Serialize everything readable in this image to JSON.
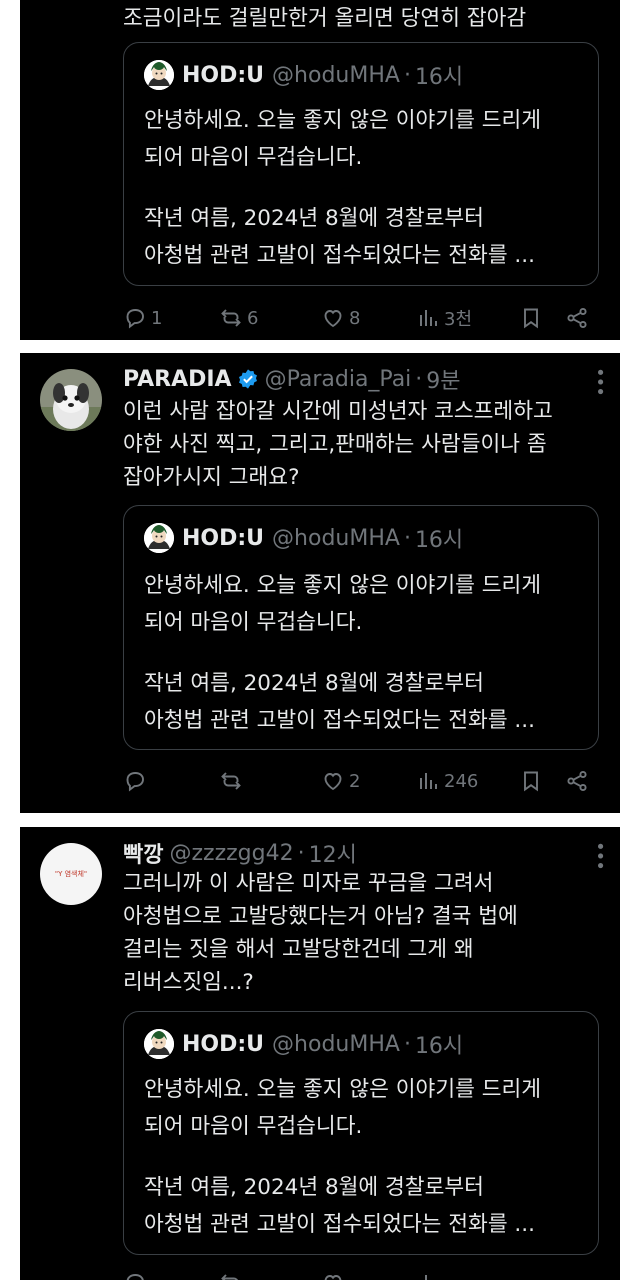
{
  "tweets": [
    {
      "text_lines": [
        "조금이라도 걸릴만한거 올리면 당연히 잡아감"
      ],
      "quote": {
        "name": "HOD:U",
        "handle": "@hoduMHA",
        "time": "16시",
        "lines": [
          "안녕하세요. 오늘 좋지 않은 이야기를 드리게",
          "되어 마음이 무겁습니다.",
          "작년 여름, 2024년 8월에 경찰로부터",
          "아청법 관련 고발이 접수되었다는 전화를 ..."
        ]
      },
      "actions": {
        "reply": "1",
        "retweet": "6",
        "like": "8",
        "views": "3천"
      }
    },
    {
      "name": "PARADIA",
      "handle": "@Paradia_Pai",
      "time": "9분",
      "verified": true,
      "text_lines": [
        "이런 사람 잡아갈 시간에 미성년자 코스프레하고",
        "야한 사진 찍고, 그리고,판매하는 사람들이나 좀",
        "잡아가시지 그래요?"
      ],
      "quote": {
        "name": "HOD:U",
        "handle": "@hoduMHA",
        "time": "16시",
        "lines": [
          "안녕하세요. 오늘 좋지 않은 이야기를 드리게",
          "되어 마음이 무겁습니다.",
          "작년 여름, 2024년 8월에 경찰로부터",
          "아청법 관련 고발이 접수되었다는 전화를 ..."
        ]
      },
      "actions": {
        "reply": "",
        "retweet": "",
        "like": "2",
        "views": "246"
      }
    },
    {
      "name": "빡깡",
      "handle": "@zzzzgg42",
      "time": "12시",
      "avatar_text": "\"Y 염색체\"",
      "text_lines": [
        "그러니까 이 사람은 미자로 꾸금을 그려서",
        "아청법으로 고발당했다는거 아님? 결국 법에",
        "걸리는 짓을 해서 고발당한건데 그게 왜",
        "리버스짓임...?"
      ],
      "quote": {
        "name": "HOD:U",
        "handle": "@hoduMHA",
        "time": "16시",
        "lines": [
          "안녕하세요. 오늘 좋지 않은 이야기를 드리게",
          "되어 마음이 무겁습니다.",
          "작년 여름, 2024년 8월에 경찰로부터",
          "아청법 관련 고발이 접수되었다는 전화를 ..."
        ]
      }
    }
  ],
  "dot": "·",
  "more": "•••",
  "colors": {
    "background": "#000000",
    "text": "#e7e9ea",
    "muted": "#71767b",
    "border": "#3a3f44",
    "verified": "#1d9bf0"
  }
}
